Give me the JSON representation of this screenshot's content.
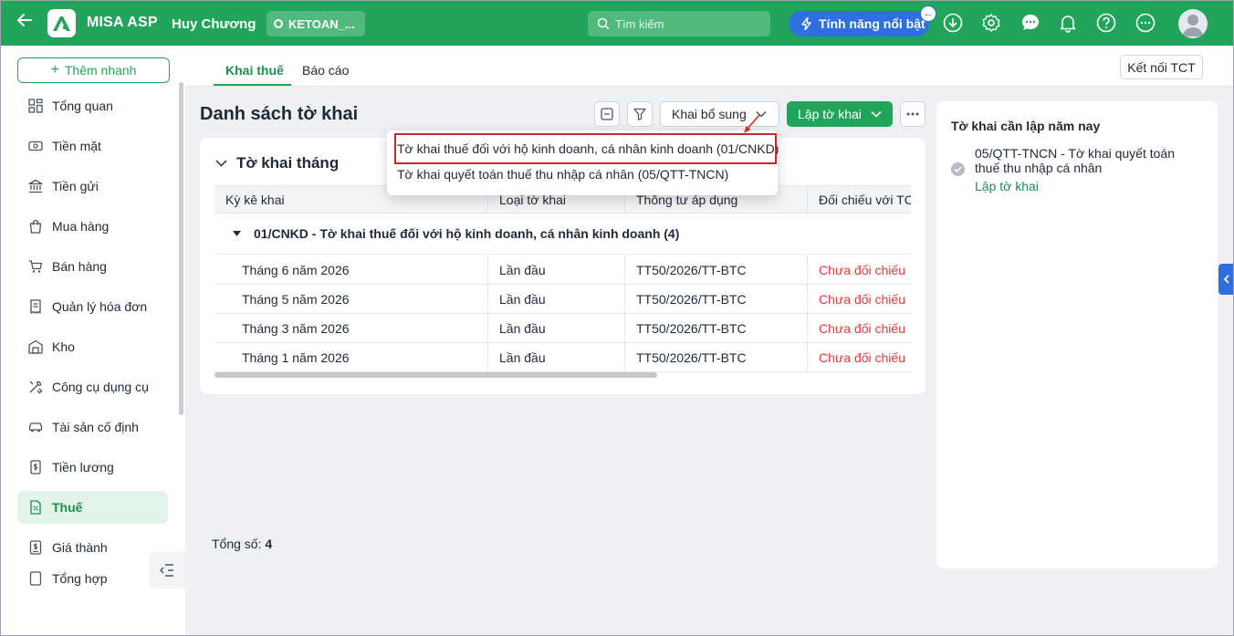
{
  "header": {
    "app_name": "MISA ASP",
    "user_name": "Huy Chương",
    "database": "KETOAN_...",
    "search_placeholder": "Tìm kiếm",
    "feature_button": "Tính năng nổi bật"
  },
  "sidebar": {
    "quick_add": "Thêm nhanh",
    "items": [
      {
        "label": "Tổng quan",
        "icon": "grid-icon"
      },
      {
        "label": "Tiền mặt",
        "icon": "cash-icon"
      },
      {
        "label": "Tiền gửi",
        "icon": "bank-icon"
      },
      {
        "label": "Mua hàng",
        "icon": "bag-icon"
      },
      {
        "label": "Bán hàng",
        "icon": "cart-icon"
      },
      {
        "label": "Quản lý hóa đơn",
        "icon": "invoice-icon"
      },
      {
        "label": "Kho",
        "icon": "warehouse-icon"
      },
      {
        "label": "Công cụ dụng cụ",
        "icon": "tools-icon"
      },
      {
        "label": "Tài sản cố định",
        "icon": "car-icon"
      },
      {
        "label": "Tiền lương",
        "icon": "salary-icon"
      },
      {
        "label": "Thuế",
        "icon": "tax-icon",
        "active": true
      },
      {
        "label": "Giá thành",
        "icon": "cost-icon"
      },
      {
        "label": "Tổng hợp",
        "icon": "summary-icon"
      }
    ]
  },
  "tabs": [
    {
      "label": "Khai thuế",
      "active": true
    },
    {
      "label": "Báo cáo"
    }
  ],
  "connect_button": "Kết nối TCT",
  "main": {
    "title": "Danh sách tờ khai",
    "supplement_button": "Khai bổ sung",
    "create_button": "Lập tờ khai",
    "dropdown_items": [
      "Tờ khai thuế đối với hộ kinh doanh, cá nhân kinh doanh (01/CNKD)",
      "Tờ khai quyết toán thuế thu nhập cá nhân (05/QTT-TNCN)"
    ],
    "section_title": "Tờ khai tháng",
    "columns": [
      "Kỳ kê khai",
      "Loại tờ khai",
      "Thông tư áp dụng",
      "Đối chiếu với TC"
    ],
    "group_label": "01/CNKD - Tờ khai thuế đối với hộ kinh doanh, cá nhân kinh doanh",
    "group_count": "(4)",
    "rows": [
      {
        "period": "Tháng 6 năm 2026",
        "type": "Lần đầu",
        "circular": "TT50/2026/TT-BTC",
        "status": "Chưa đối chiếu"
      },
      {
        "period": "Tháng 5 năm 2026",
        "type": "Lần đầu",
        "circular": "TT50/2026/TT-BTC",
        "status": "Chưa đối chiếu"
      },
      {
        "period": "Tháng 3 năm 2026",
        "type": "Lần đầu",
        "circular": "TT50/2026/TT-BTC",
        "status": "Chưa đối chiếu"
      },
      {
        "period": "Tháng 1 năm 2026",
        "type": "Lần đầu",
        "circular": "TT50/2026/TT-BTC",
        "status": "Chưa đối chiếu"
      }
    ],
    "total_label": "Tổng số:",
    "total_value": "4"
  },
  "right_panel": {
    "title": "Tờ khai cần lập năm nay",
    "item": "05/QTT-TNCN - Tờ khai quyết toán thuế thu nhập cá nhân",
    "link": "Lập tờ khai"
  },
  "colors": {
    "brand": "#21a55a",
    "accent_blue": "#2f6fe0",
    "status_red": "#e5393c",
    "highlight_border": "#c62828"
  }
}
